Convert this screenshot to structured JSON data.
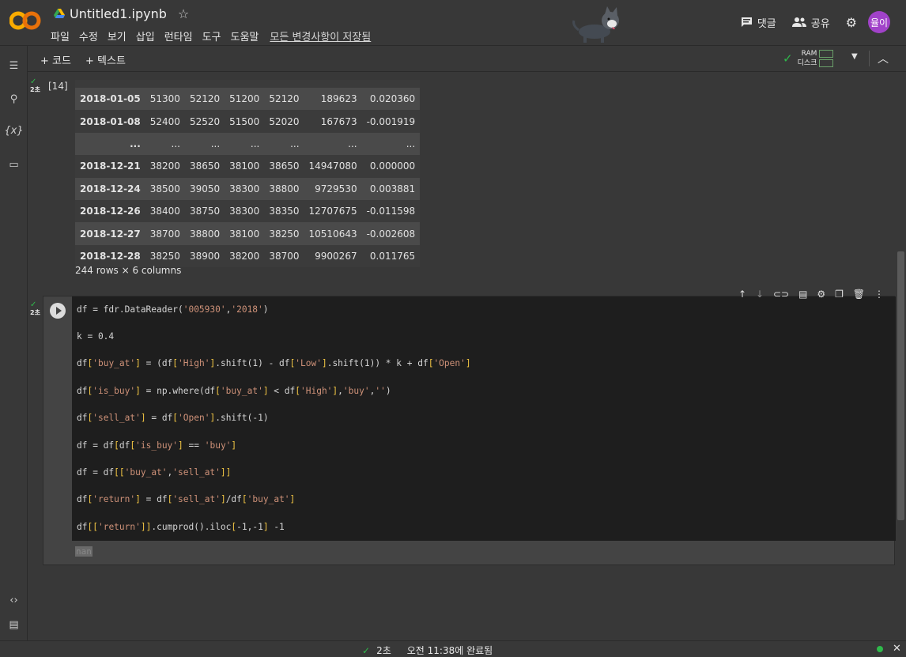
{
  "header": {
    "notebook_title": "Untitled1.ipynb",
    "star": "☆",
    "menu": [
      "파일",
      "수정",
      "보기",
      "삽입",
      "런타임",
      "도구",
      "도움말"
    ],
    "saved_status": "모든 변경사항이 저장됨",
    "comment_label": "댓글",
    "share_label": "공유",
    "avatar_text": "율이"
  },
  "toolbar": {
    "add_code": "+ 코드",
    "add_text": "+ 텍스트",
    "ram_label": "RAM",
    "disk_label": "디스크"
  },
  "cell1": {
    "exec_count": "[14]",
    "exec_time": "2초",
    "rows": [
      [
        "2018-01-05",
        "51300",
        "52120",
        "51200",
        "52120",
        "189623",
        "0.020360"
      ],
      [
        "2018-01-08",
        "52400",
        "52520",
        "51500",
        "52020",
        "167673",
        "-0.001919"
      ],
      [
        "...",
        "...",
        "...",
        "...",
        "...",
        "...",
        "..."
      ],
      [
        "2018-12-21",
        "38200",
        "38650",
        "38100",
        "38650",
        "14947080",
        "0.000000"
      ],
      [
        "2018-12-24",
        "38500",
        "39050",
        "38300",
        "38800",
        "9729530",
        "0.003881"
      ],
      [
        "2018-12-26",
        "38400",
        "38750",
        "38300",
        "38350",
        "12707675",
        "-0.011598"
      ],
      [
        "2018-12-27",
        "38700",
        "38800",
        "38100",
        "38250",
        "10510643",
        "-0.002608"
      ],
      [
        "2018-12-28",
        "38250",
        "38900",
        "38200",
        "38700",
        "9900267",
        "0.011765"
      ]
    ],
    "caption": "244 rows × 6 columns"
  },
  "cell2": {
    "exec_time": "2초",
    "output": "nan"
  },
  "status": {
    "elapsed": "2초",
    "completed": "오전 11:38에 완료됨"
  },
  "colors": {
    "background": "#383838",
    "code_bg": "#1e1e1e",
    "accent_green": "#2fb94b",
    "avatar": "#a142c9",
    "string": "#ce9178",
    "bracket": "#f0c443"
  }
}
